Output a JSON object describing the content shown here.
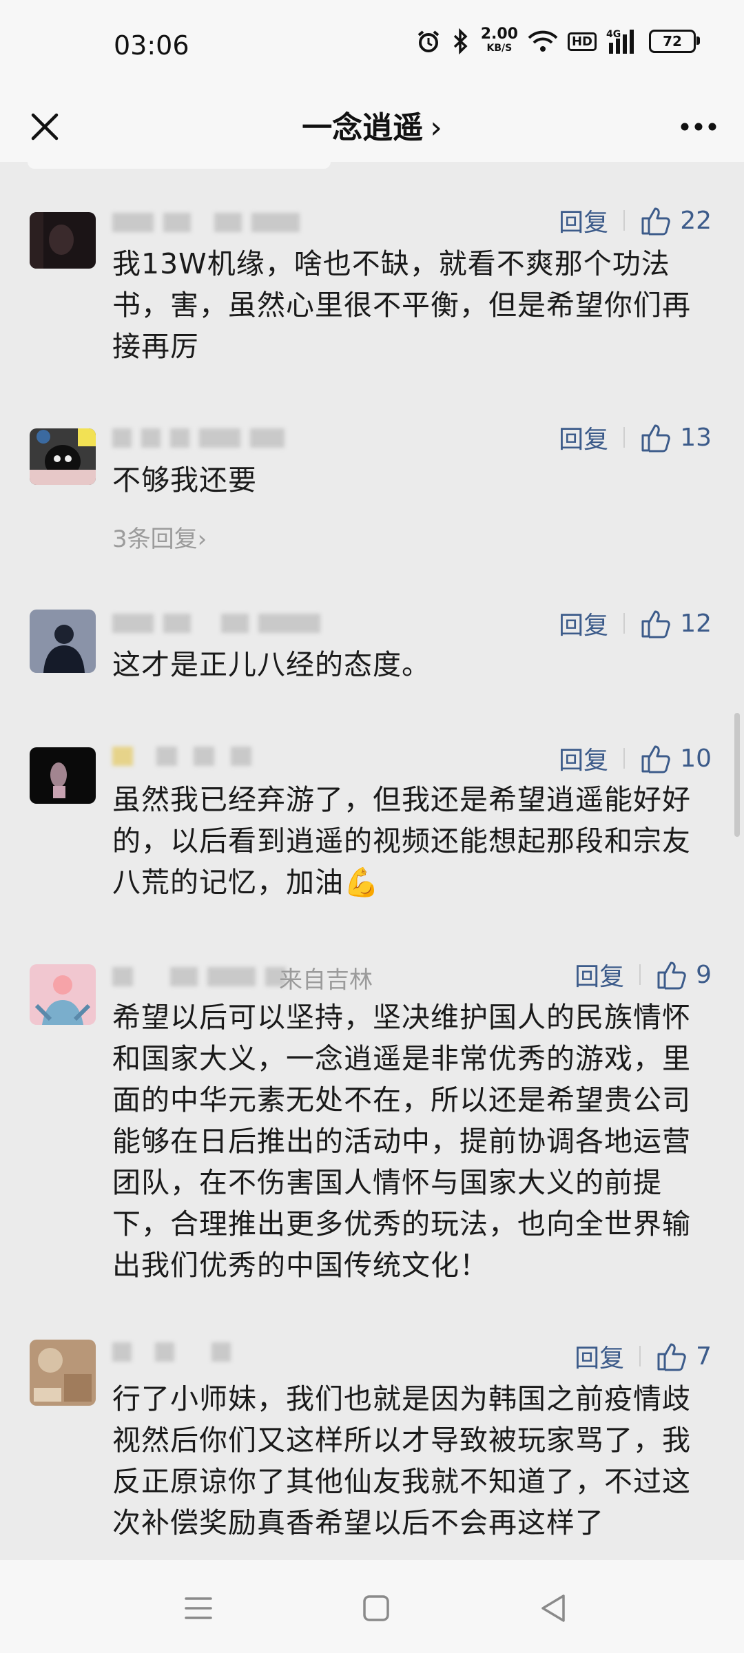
{
  "status_bar": {
    "time": "03:06",
    "net_speed": "2.00",
    "net_unit": "KB/S",
    "hd": "HD",
    "signal_label": "4G",
    "battery": "72",
    "icons": [
      "alarm-icon",
      "bluetooth-icon",
      "wifi-icon",
      "signal-icon",
      "battery-icon"
    ]
  },
  "nav": {
    "title": "一念逍遥",
    "chevron": "›",
    "close_icon": "close-icon",
    "more_icon": "more-icon"
  },
  "reply_label": "回复",
  "comments": [
    {
      "likes": "22",
      "text": "我13W机缘，啥也不缺，就看不爽那个功法书，害，虽然心里很不平衡，但是希望你们再接再厉"
    },
    {
      "likes": "13",
      "text": "不够我还要",
      "sub_replies": "3条回复›"
    },
    {
      "likes": "12",
      "text": "这才是正儿八经的态度。"
    },
    {
      "likes": "10",
      "text": "虽然我已经弃游了，但我还是希望逍遥能好好的，以后看到逍遥的视频还能想起那段和宗友八荒的记忆，加油💪"
    },
    {
      "likes": "9",
      "location": "来自吉林",
      "text": "希望以后可以坚持，坚决维护国人的民族情怀和国家大义，一念逍遥是非常优秀的游戏，里面的中华元素无处不在，所以还是希望贵公司能够在日后推出的活动中，提前协调各地运营团队，在不伤害国人情怀与国家大义的前提下，合理推出更多优秀的玩法，也向全世界输出我们优秀的中国传统文化！"
    },
    {
      "likes": "7",
      "text": "行了小师妹，我们也就是因为韩国之前疫情歧视然后你们又这样所以才导致被玩家骂了，我反正原谅你了其他仙友我就不知道了，不过这次补偿奖励真香希望以后不会再这样了"
    }
  ],
  "bottom_nav": {
    "icons": [
      "menu-icon",
      "home-icon",
      "back-icon"
    ]
  }
}
